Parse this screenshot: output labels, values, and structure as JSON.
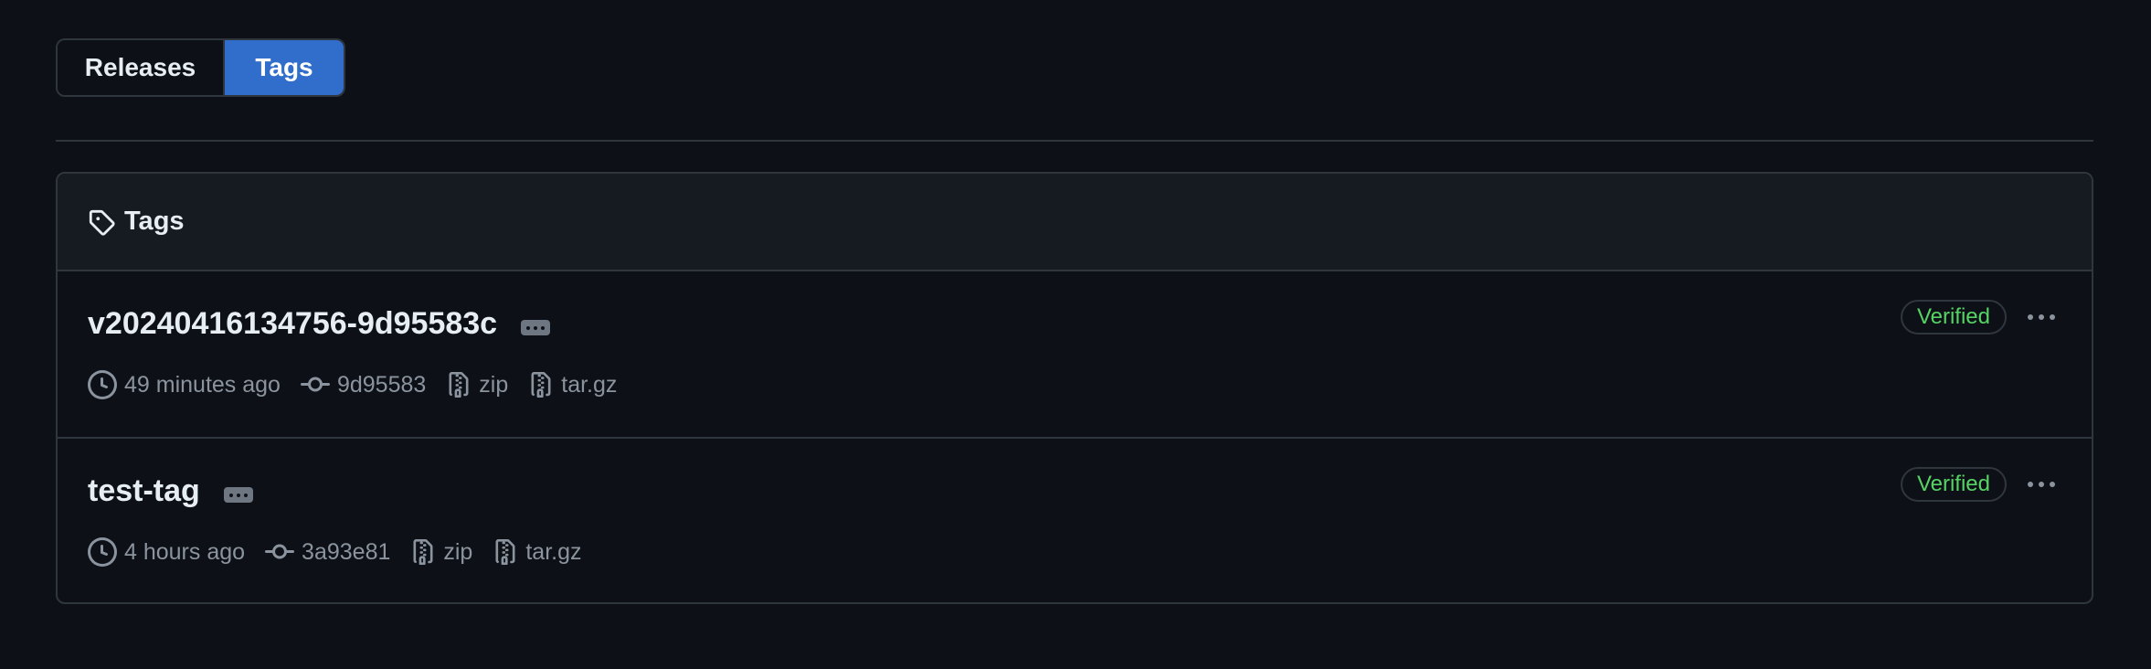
{
  "tabs": {
    "releases_label": "Releases",
    "tags_label": "Tags",
    "active": "Tags"
  },
  "panel": {
    "title": "Tags",
    "icon": "tag-icon"
  },
  "tags": [
    {
      "name": "v20240416134756-9d95583c",
      "time": "49 minutes ago",
      "commit": "9d95583",
      "zip_label": "zip",
      "targz_label": "tar.gz",
      "badge": "Verified"
    },
    {
      "name": "test-tag",
      "time": "4 hours ago",
      "commit": "3a93e81",
      "zip_label": "zip",
      "targz_label": "tar.gz",
      "badge": "Verified"
    }
  ],
  "colors": {
    "background": "#0d1117",
    "accent": "#316dca",
    "verified": "#56d364",
    "muted": "#8b949e",
    "border": "#30363d"
  }
}
